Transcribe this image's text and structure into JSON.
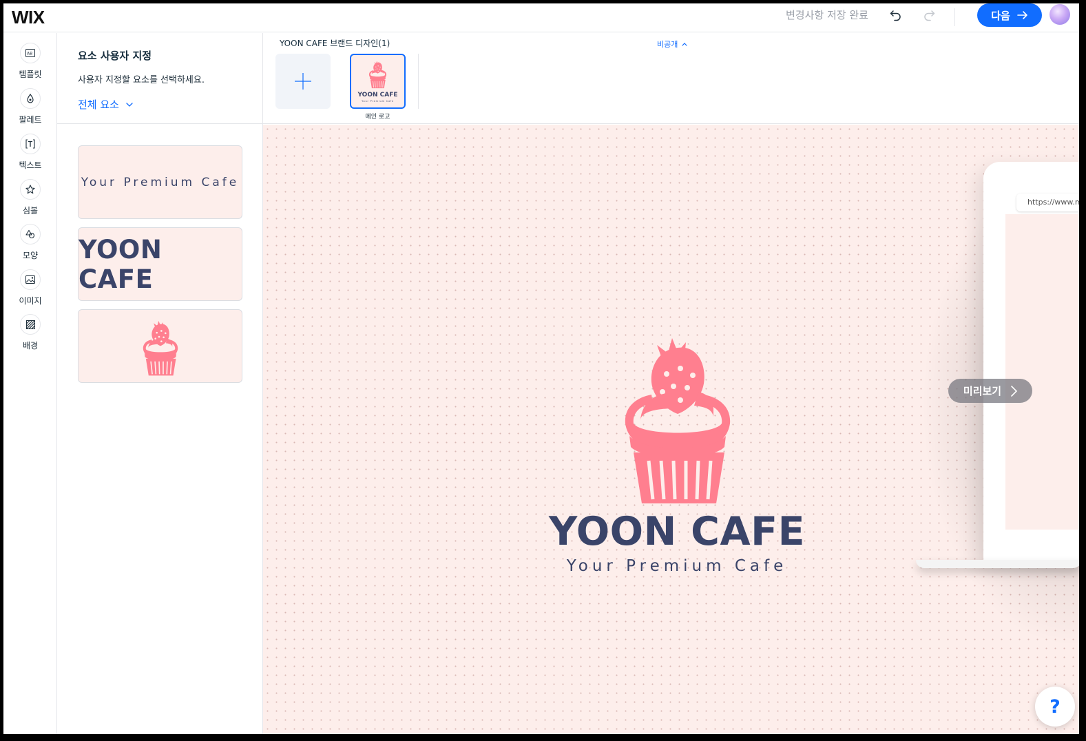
{
  "app": {
    "logo": "WIX"
  },
  "topbar": {
    "save_status": "변경사항 저장 완료",
    "next_label": "다음",
    "undo_icon": "undo-icon",
    "redo_icon": "redo-icon",
    "accent_color": "#116dff"
  },
  "rail": {
    "items": [
      {
        "label": "템플릿",
        "icon": "template-icon"
      },
      {
        "label": "팔레트",
        "icon": "palette-icon"
      },
      {
        "label": "텍스트",
        "icon": "text-icon"
      },
      {
        "label": "심볼",
        "icon": "star-icon"
      },
      {
        "label": "모양",
        "icon": "shapes-icon"
      },
      {
        "label": "이미지",
        "icon": "image-icon"
      },
      {
        "label": "배경",
        "icon": "background-icon"
      }
    ]
  },
  "panel": {
    "title": "요소 사용자 지정",
    "subtitle": "사용자 지정할 요소를 선택하세요.",
    "filter_label": "전체 요소",
    "cards": {
      "tagline": "Your Premium Cafe",
      "name": "YOON CAFE",
      "icon": "cupcake-icon"
    }
  },
  "strip": {
    "title": "YOON CAFE 브랜드 디자인(1)",
    "visibility": "비공개",
    "designs": [
      {
        "label": "메인 로고",
        "name": "YOON CAFE",
        "tagline": "Your Premium Cafe"
      }
    ]
  },
  "canvas": {
    "logo_name": "YOON CAFE",
    "logo_tagline": "Your Premium Cafe",
    "preview_label": "미리보기",
    "url_text": "https://www.my",
    "help_label": "?",
    "colors": {
      "background": "#fdeeeb",
      "logo_pink": "#ff7f8f",
      "logo_navy": "#3a4469"
    }
  }
}
